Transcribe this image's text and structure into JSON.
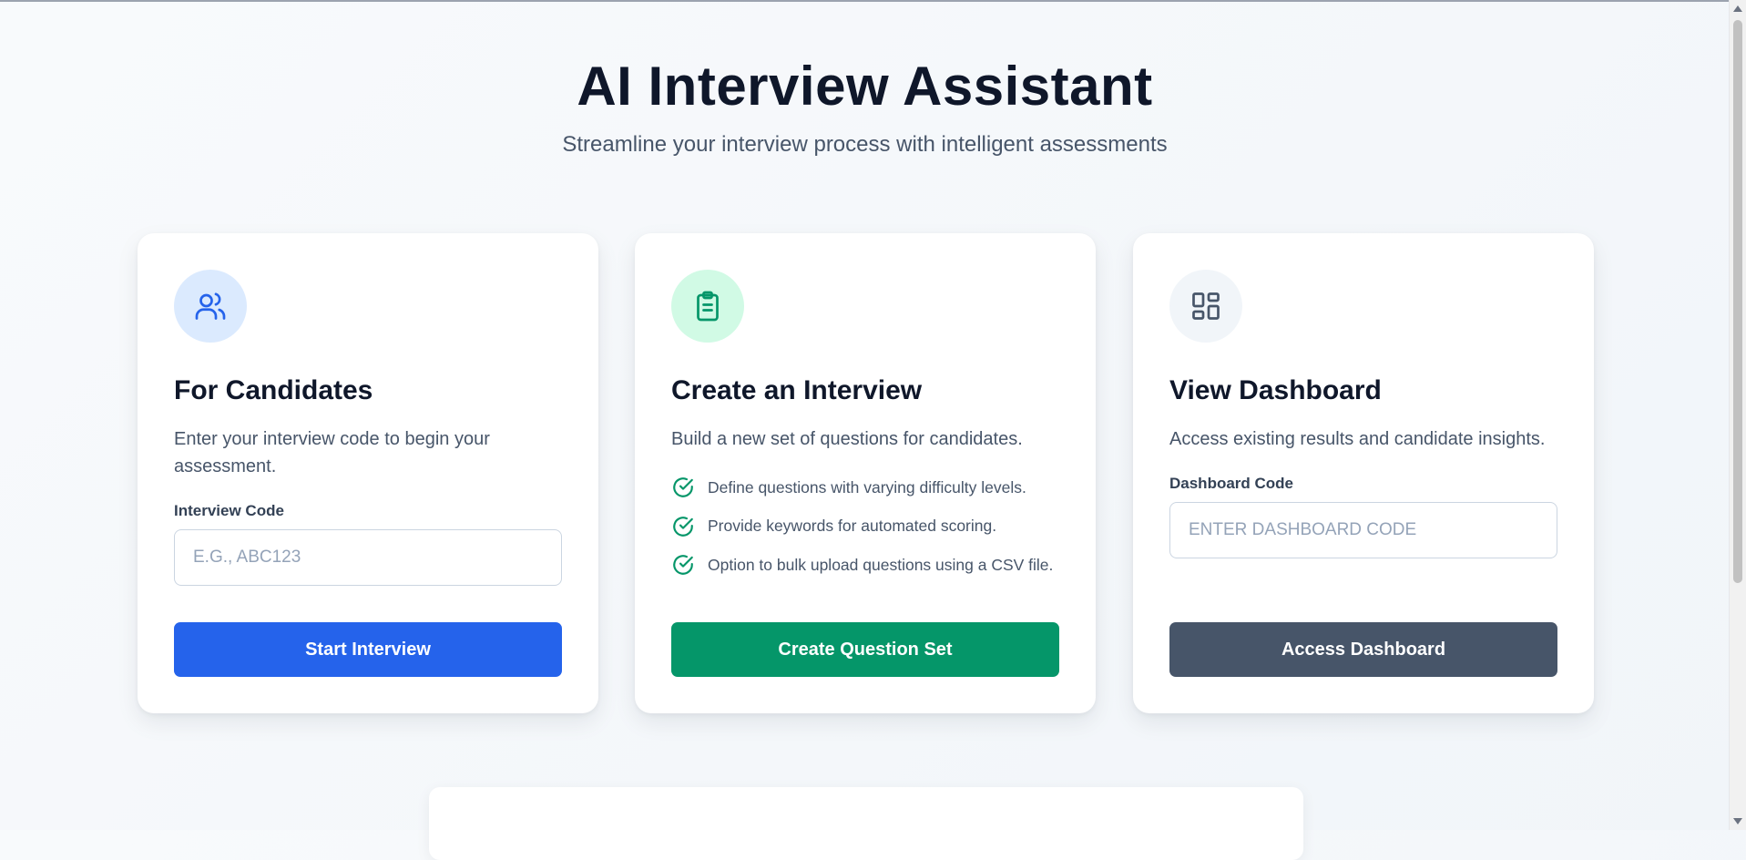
{
  "header": {
    "title": "AI Interview Assistant",
    "subtitle": "Streamline your interview process with intelligent assessments"
  },
  "cards": [
    {
      "icon": "users-icon",
      "icon_color": "#2563eb",
      "title": "For Candidates",
      "description": "Enter your interview code to begin your assessment.",
      "field_label": "Interview Code",
      "field_placeholder": "E.G., ABC123",
      "field_value": "",
      "button_label": "Start Interview",
      "button_color": "#2563eb"
    },
    {
      "icon": "clipboard-icon",
      "icon_color": "#059669",
      "title": "Create an Interview",
      "description": "Build a new set of questions for candidates.",
      "features": [
        "Define questions with varying difficulty levels.",
        "Provide keywords for automated scoring.",
        "Option to bulk upload questions using a CSV file."
      ],
      "button_label": "Create Question Set",
      "button_color": "#059669"
    },
    {
      "icon": "dashboard-icon",
      "icon_color": "#475569",
      "title": "View Dashboard",
      "description": "Access existing results and candidate insights.",
      "field_label": "Dashboard Code",
      "field_placeholder": "ENTER DASHBOARD CODE",
      "field_value": "",
      "button_label": "Access Dashboard",
      "button_color": "#475569"
    }
  ]
}
